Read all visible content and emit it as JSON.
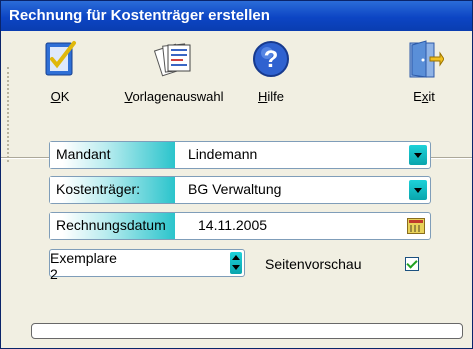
{
  "window": {
    "title": "Rechnung für Kostenträger erstellen"
  },
  "toolbar": {
    "ok": {
      "label": "OK",
      "icon": "checklist-icon"
    },
    "template": {
      "label": "Vorlagenauswahl",
      "icon": "documents-icon"
    },
    "help": {
      "label": "Hilfe",
      "icon": "help-icon"
    },
    "exit": {
      "label": "Exit",
      "icon": "door-exit-icon"
    }
  },
  "form": {
    "mandant": {
      "label": "Mandant",
      "value": "Lindemann"
    },
    "kostentraeger": {
      "label": "Kostenträger:",
      "value": "BG Verwaltung"
    },
    "rechnungsdatum": {
      "label": "Rechnungsdatum",
      "value": "14.11.2005"
    },
    "exemplare": {
      "label": "Exemplare",
      "value": "2"
    },
    "seitenvorschau": {
      "label": "Seitenvorschau",
      "checked": true
    }
  },
  "progress": {
    "value": 0
  },
  "colors": {
    "titlebar": "#0c45c4",
    "accent": "#2bc4cc",
    "window_bg": "#f1efe2"
  }
}
